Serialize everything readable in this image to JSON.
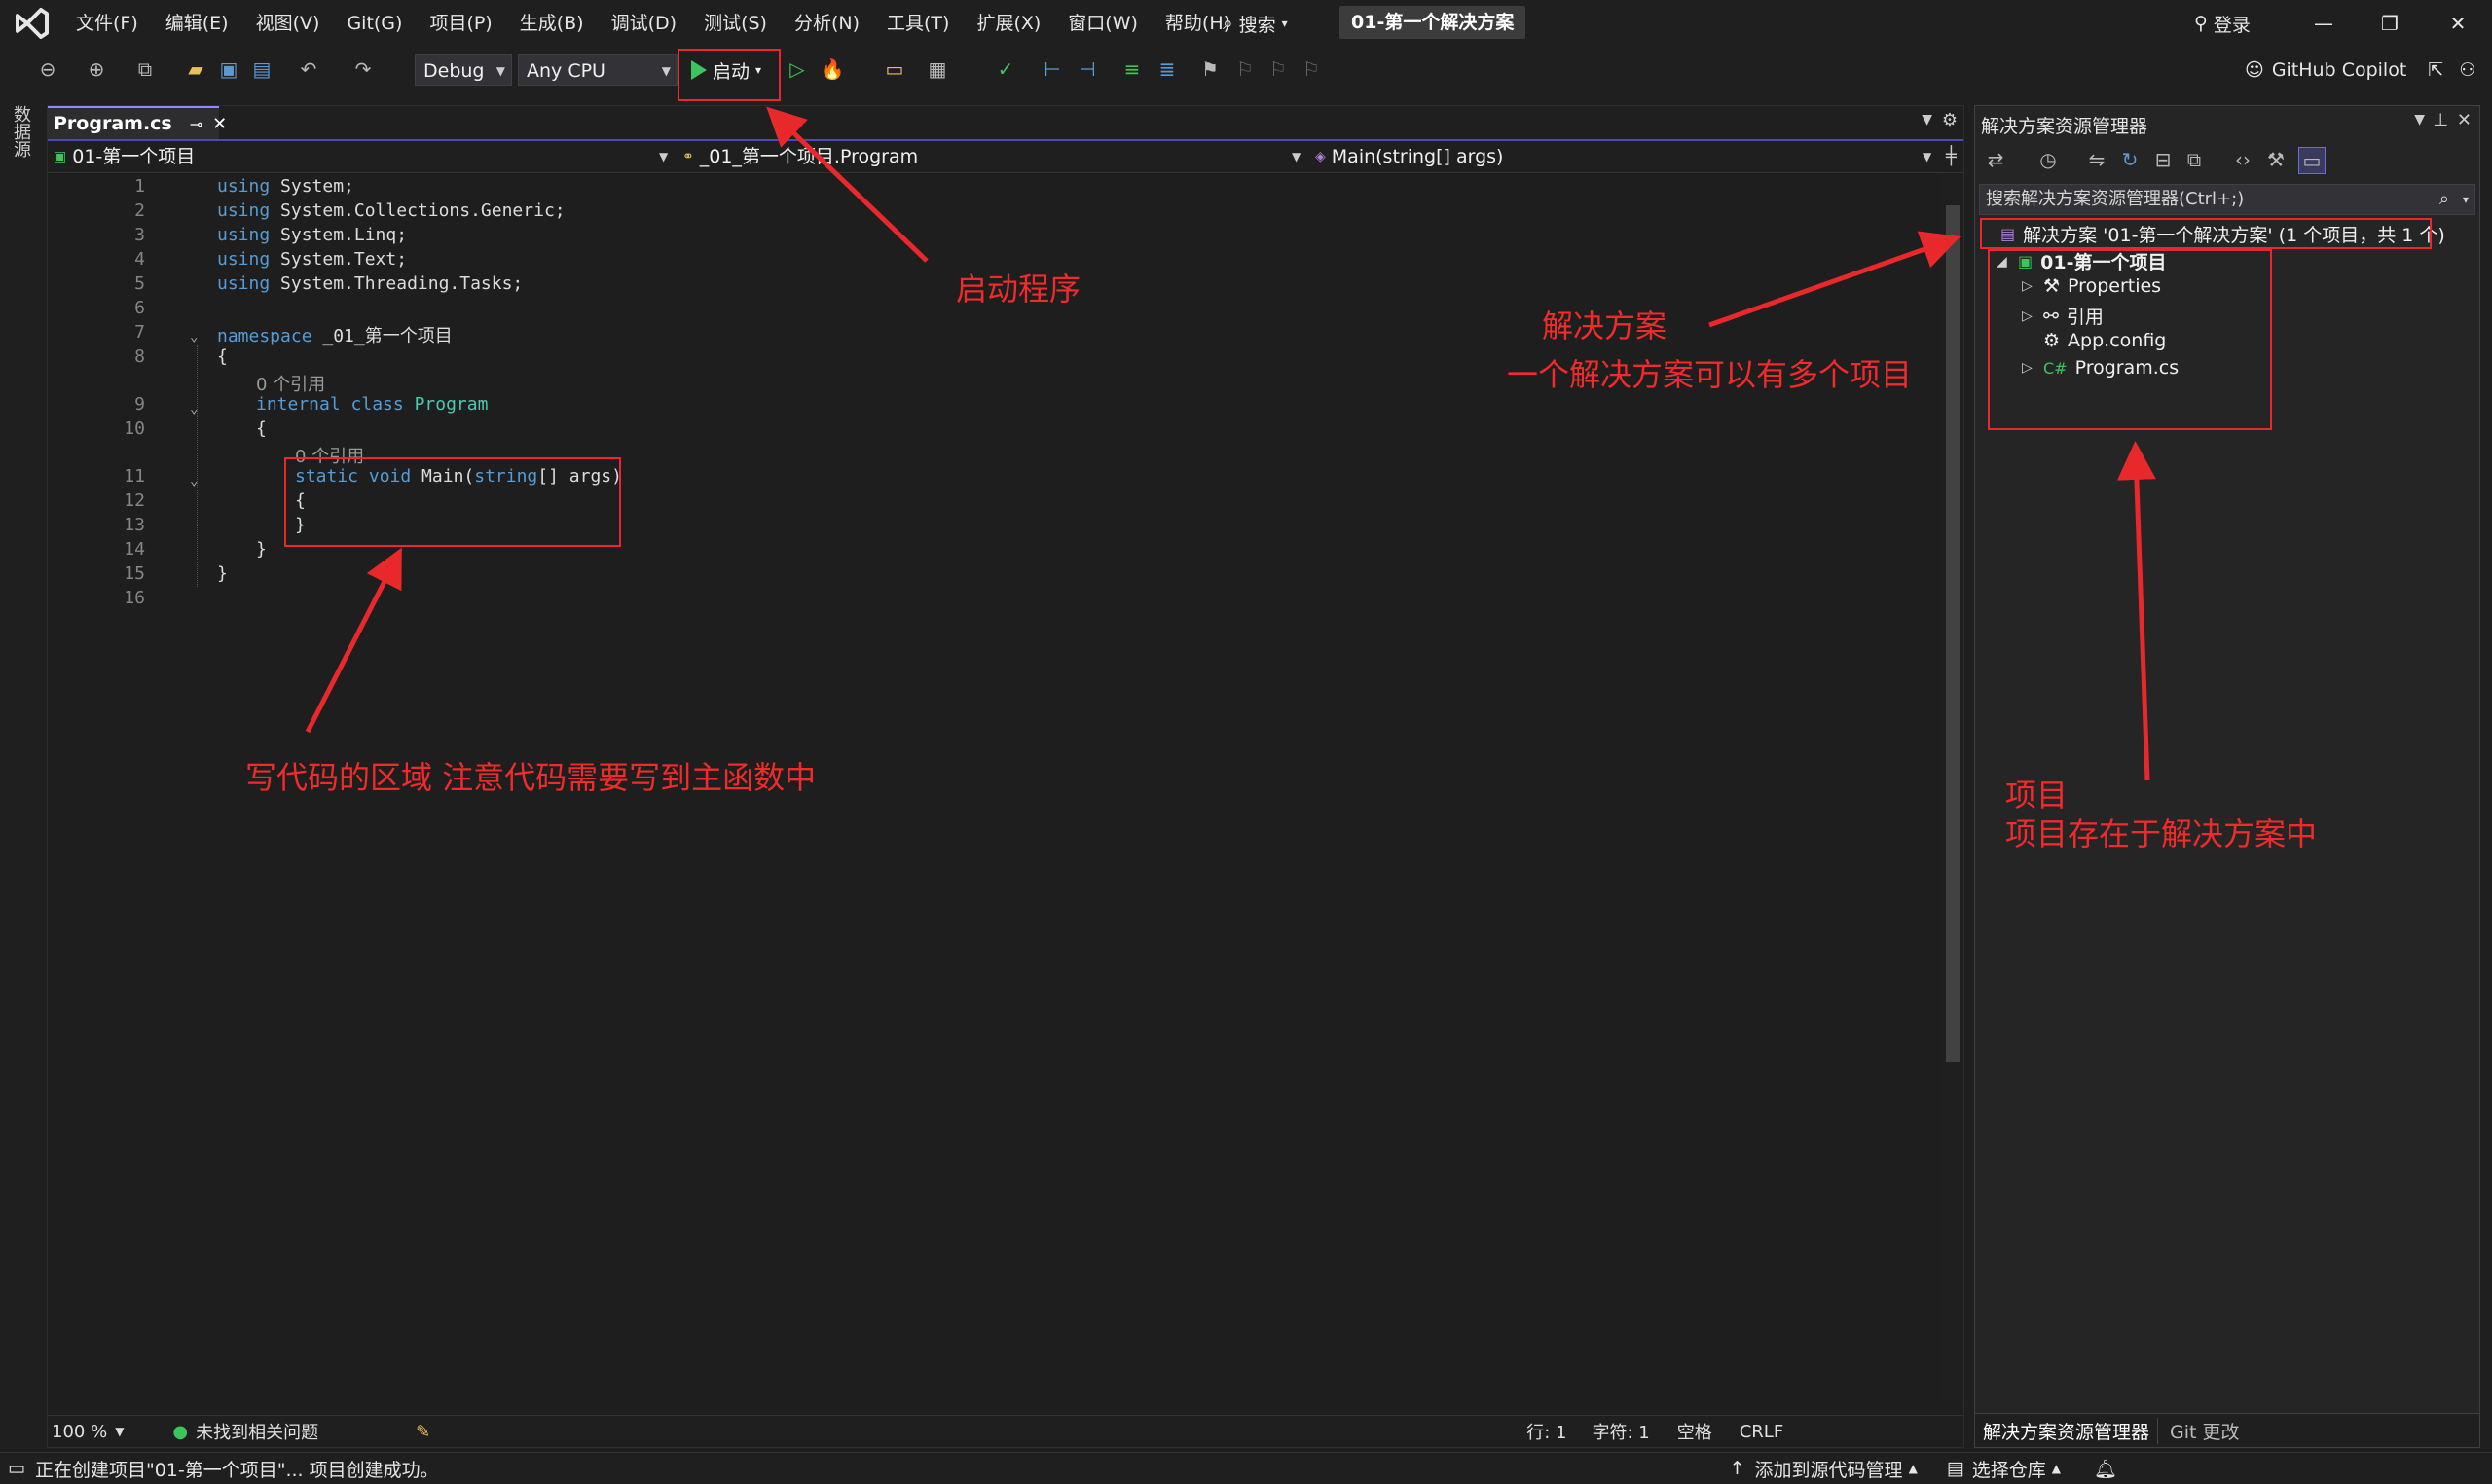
{
  "menu": {
    "items": [
      "文件(F)",
      "编辑(E)",
      "视图(V)",
      "Git(G)",
      "项目(P)",
      "生成(B)",
      "调试(D)",
      "测试(S)",
      "分析(N)",
      "工具(T)",
      "扩展(X)",
      "窗口(W)",
      "帮助(H)"
    ],
    "search_label": "搜索",
    "solution_name": "01-第一个解决方案",
    "login_label": "登录"
  },
  "toolbar": {
    "config": "Debug",
    "platform": "Any CPU",
    "start_label": "启动",
    "copilot_label": "GitHub Copilot"
  },
  "left_strip": {
    "datasource_label": "数据源"
  },
  "editor": {
    "tab_label": "Program.cs",
    "nav_project": "01-第一个项目",
    "nav_class": "_01_第一个项目.Program",
    "nav_member": "Main(string[] args)",
    "zoom": "100 %",
    "issues": "未找到相关问题",
    "line_label": "行: 1",
    "char_label": "字符: 1",
    "space_label": "空格",
    "eol_label": "CRLF",
    "refs_label": "0 个引用",
    "line_numbers": [
      "1",
      "2",
      "3",
      "4",
      "5",
      "6",
      "7",
      "8",
      "9",
      "10",
      "11",
      "12",
      "13",
      "14",
      "15",
      "16"
    ],
    "code": {
      "l1_kw": "using",
      "l1_rest": " System;",
      "l2_kw": "using",
      "l2_rest": " System.Collections.Generic;",
      "l3_kw": "using",
      "l3_rest": " System.Linq;",
      "l4_kw": "using",
      "l4_rest": " System.Text;",
      "l5_kw": "using",
      "l5_rest": " System.Threading.Tasks;",
      "l7_kw": "namespace",
      "l7_rest": " _01_第一个项目",
      "l8": "{",
      "l9_kw": "internal class",
      "l9_type": "Program",
      "l10": "{",
      "l11_kw": "static void",
      "l11_mid": " Main(",
      "l11_kw2": "string",
      "l11_rest": "[] args)",
      "l12": "{",
      "l13": "}",
      "l14": "}",
      "l15": "}"
    }
  },
  "solution_explorer": {
    "title": "解决方案资源管理器",
    "search_placeholder": "搜索解决方案资源管理器(Ctrl+;)",
    "solution_node": "解决方案 '01-第一个解决方案' (1 个项目，共 1 个)",
    "project_node": "01-第一个项目",
    "items": [
      "Properties",
      "引用",
      "App.config",
      "Program.cs"
    ],
    "bottom_tabs": [
      "解决方案资源管理器",
      "Git 更改"
    ]
  },
  "statusbar": {
    "message": "正在创建项目\"01-第一个项目\"... 项目创建成功。",
    "add_source": "添加到源代码管理",
    "select_repo": "选择仓库"
  },
  "annotations": {
    "start": "启动程序",
    "code_area": "写代码的区域 注意代码需要写到主函数中",
    "solution_title": "解决方案",
    "solution_desc": "一个解决方案可以有多个项目",
    "project_title": "项目",
    "project_desc": "项目存在于解决方案中"
  },
  "colors": {
    "annotation_red": "#e8282a",
    "keyword": "#569cd6",
    "type": "#4ec9b0",
    "play_green": "#3bc55c"
  }
}
